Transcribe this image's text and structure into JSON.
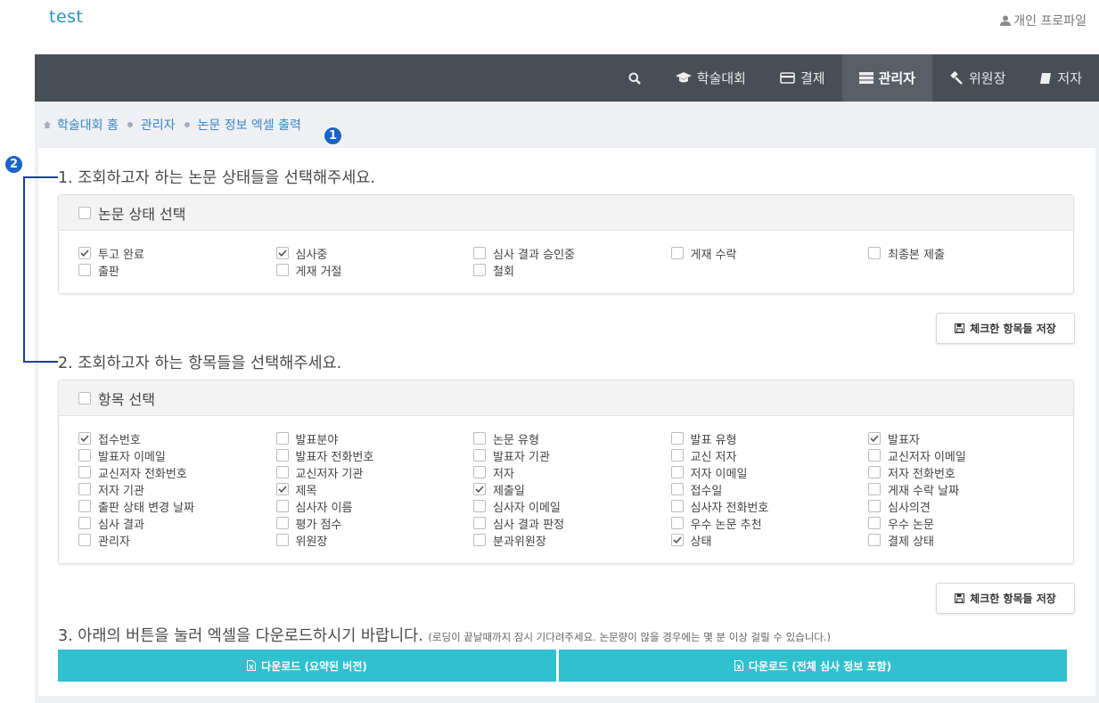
{
  "app": {
    "brand": "test",
    "profile_label": "개인 프로파일"
  },
  "nav": {
    "items": [
      {
        "icon": "search-icon",
        "label": ""
      },
      {
        "icon": "graduation-cap-icon",
        "label": "학술대회"
      },
      {
        "icon": "credit-card-icon",
        "label": "결제"
      },
      {
        "icon": "server-icon",
        "label": "관리자",
        "active": true
      },
      {
        "icon": "gavel-icon",
        "label": "위원장"
      },
      {
        "icon": "book-icon",
        "label": "저자"
      }
    ]
  },
  "breadcrumb": [
    "학술대회 홈",
    "관리자",
    "논문 정보 엑셀 출력"
  ],
  "annotations": [
    "1",
    "2"
  ],
  "step1": {
    "title": "1. 조회하고자 하는 논문 상태들을 선택해주세요.",
    "select_all_label": "논문 상태 선택",
    "save_label": "체크한 항목들 저장",
    "options": [
      {
        "label": "투고 완료",
        "checked": true
      },
      {
        "label": "심사중",
        "checked": true
      },
      {
        "label": "심사 결과 승인중",
        "checked": false
      },
      {
        "label": "게재 수락",
        "checked": false
      },
      {
        "label": "최종본 제출",
        "checked": false
      },
      {
        "label": "출판",
        "checked": false
      },
      {
        "label": "게재 거절",
        "checked": false
      },
      {
        "label": "철회",
        "checked": false
      }
    ]
  },
  "step2": {
    "title": "2. 조회하고자 하는 항목들을 선택해주세요.",
    "select_all_label": "항목 선택",
    "save_label": "체크한 항목들 저장",
    "options": [
      {
        "label": "접수번호",
        "checked": true
      },
      {
        "label": "발표분야",
        "checked": false
      },
      {
        "label": "논문 유형",
        "checked": false
      },
      {
        "label": "발표 유형",
        "checked": false
      },
      {
        "label": "발표자",
        "checked": true
      },
      {
        "label": "발표자 이메일",
        "checked": false
      },
      {
        "label": "발표자 전화번호",
        "checked": false
      },
      {
        "label": "발표자 기관",
        "checked": false
      },
      {
        "label": "교신 저자",
        "checked": false
      },
      {
        "label": "교신저자 이메일",
        "checked": false
      },
      {
        "label": "교신저자 전화번호",
        "checked": false
      },
      {
        "label": "교신저자 기관",
        "checked": false
      },
      {
        "label": "저자",
        "checked": false
      },
      {
        "label": "저자 이메일",
        "checked": false
      },
      {
        "label": "저자 전화번호",
        "checked": false
      },
      {
        "label": "저자 기관",
        "checked": false
      },
      {
        "label": "제목",
        "checked": true
      },
      {
        "label": "제출일",
        "checked": true
      },
      {
        "label": "접수일",
        "checked": false
      },
      {
        "label": "게재 수락 날짜",
        "checked": false
      },
      {
        "label": "출판 상태 변경 날짜",
        "checked": false
      },
      {
        "label": "심사자 이름",
        "checked": false
      },
      {
        "label": "심사자 이메일",
        "checked": false
      },
      {
        "label": "심사자 전화번호",
        "checked": false
      },
      {
        "label": "심사의견",
        "checked": false
      },
      {
        "label": "심사 결과",
        "checked": false
      },
      {
        "label": "평가 점수",
        "checked": false
      },
      {
        "label": "심사 결과 판정",
        "checked": false
      },
      {
        "label": "우수 논문 추천",
        "checked": false
      },
      {
        "label": "우수 논문",
        "checked": false
      },
      {
        "label": "관리자",
        "checked": false
      },
      {
        "label": "위원장",
        "checked": false
      },
      {
        "label": "분과위원장",
        "checked": false
      },
      {
        "label": "상태",
        "checked": true
      },
      {
        "label": "결제 상태",
        "checked": false
      }
    ]
  },
  "step3": {
    "title": "3. 아래의 버튼을 눌러 엑셀을 다운로드하시기 바랍니다.",
    "note": "(로딩이 끝날때까지 잠시 기다려주세요. 논문량이 많을 경우에는 몇 분 이상 걸릴 수 있습니다.)",
    "download_summary_label": "다운로드 (요약된 버전)",
    "download_full_label": "다운로드 (전체 심사 정보 포함)"
  },
  "colors": {
    "nav_bg": "#484e55",
    "nav_active": "#585f67",
    "accent": "#2fc1cf",
    "link": "#3a86c8",
    "badge": "#1a63c8"
  }
}
